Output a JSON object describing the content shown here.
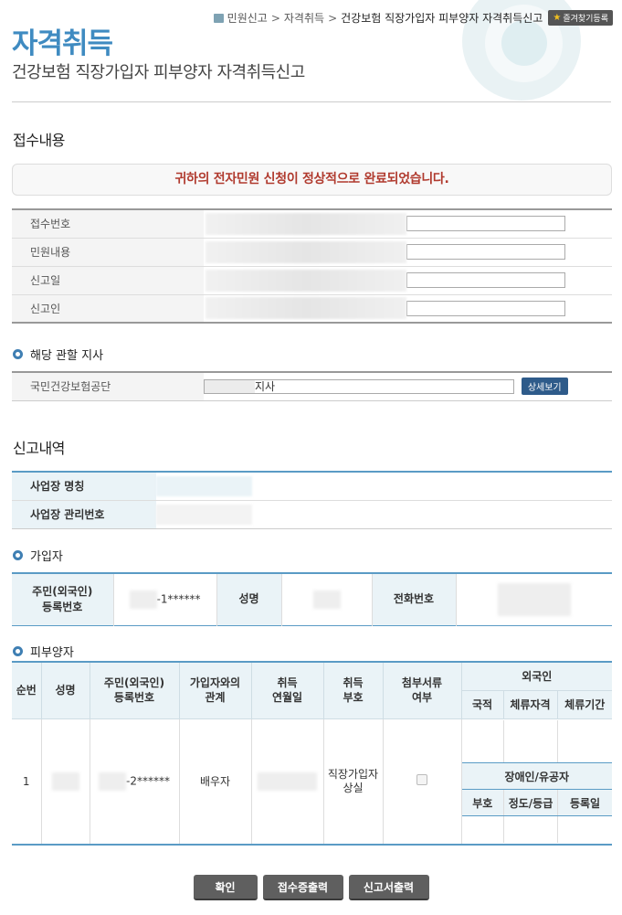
{
  "breadcrumb": {
    "home": "민원신고",
    "level2": "자격취득",
    "current": "건강보험 직장가입자 피부양자 자격취득신고",
    "favorite_label": "즐겨찾기등록"
  },
  "header": {
    "title": "자격취득",
    "subtitle": "건강보험 직장가입자 피부양자 자격취득신고"
  },
  "receipt": {
    "section_title": "접수내용",
    "notice": "귀하의 전자민원 신청이 정상적으로 완료되었습니다.",
    "rows": [
      {
        "label": "접수번호"
      },
      {
        "label": "민원내용"
      },
      {
        "label": "신고일"
      },
      {
        "label": "신고인"
      }
    ]
  },
  "branch": {
    "heading": "해당 관할 지사",
    "label": "국민건강보험공단",
    "value": "지사",
    "detail_button": "상세보기"
  },
  "report": {
    "section_title": "신고내역",
    "workplace_name_label": "사업장 명칭",
    "workplace_number_label": "사업장 관리번호"
  },
  "member": {
    "heading": "가입자",
    "rrn_label_1": "주민(외국인)",
    "rrn_label_2": "등록번호",
    "rrn_value": "-1******",
    "name_label": "성명",
    "phone_label": "전화번호"
  },
  "dependent": {
    "heading": "피부양자",
    "headers": {
      "seq": "순번",
      "name": "성명",
      "rrn_1": "주민(외국인)",
      "rrn_2": "등록번호",
      "relation_1": "가입자와의",
      "relation_2": "관계",
      "acq_date_1": "취득",
      "acq_date_2": "연월일",
      "acq_code_1": "취득",
      "acq_code_2": "부호",
      "attach_1": "첨부서류",
      "attach_2": "여부",
      "foreigner": "외국인",
      "nationality": "국적",
      "stay_status": "체류자격",
      "stay_period": "체류기간",
      "disabled": "장애인/유공자",
      "code": "부호",
      "degree": "정도/등급",
      "reg_date": "등록일"
    },
    "row": {
      "seq": "1",
      "rrn": "-2******",
      "relation": "배우자",
      "acq_code_1": "직장가입자",
      "acq_code_2": "상실"
    }
  },
  "buttons": {
    "confirm": "확인",
    "receipt_print": "접수증출력",
    "report_print": "신고서출력"
  }
}
